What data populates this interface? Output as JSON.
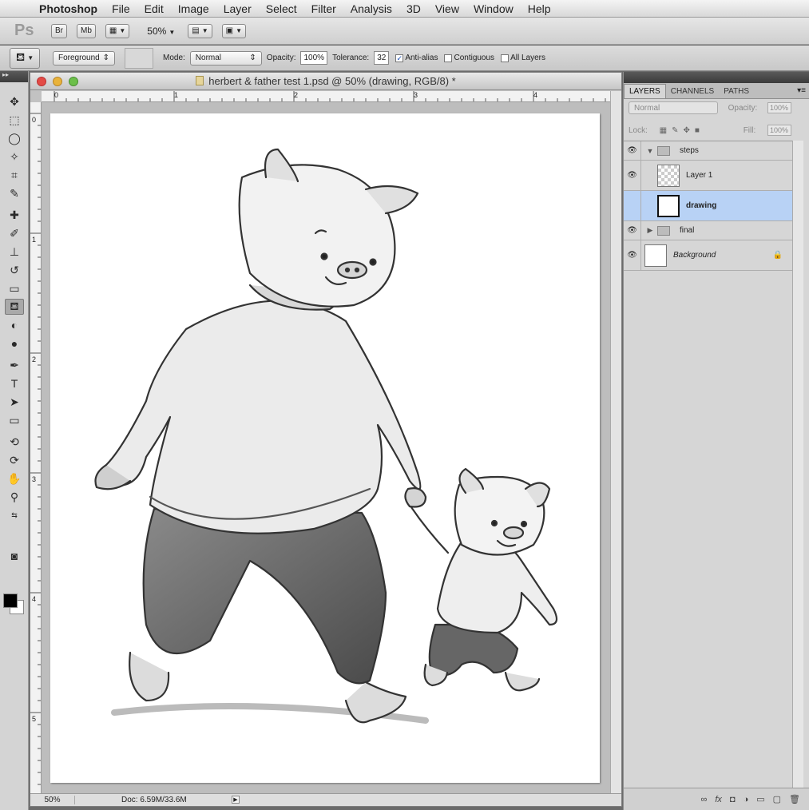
{
  "menubar": {
    "items": [
      "Photoshop",
      "File",
      "Edit",
      "Image",
      "Layer",
      "Select",
      "Filter",
      "Analysis",
      "3D",
      "View",
      "Window",
      "Help"
    ]
  },
  "appbar": {
    "logo": "Ps",
    "bridge_label": "Br",
    "minibridge_label": "Mb",
    "zoom": "50%"
  },
  "options": {
    "fill_source": "Foreground",
    "mode_label": "Mode:",
    "mode_value": "Normal",
    "opacity_label": "Opacity:",
    "opacity_value": "100%",
    "tolerance_label": "Tolerance:",
    "tolerance_value": "32",
    "antialias_label": "Anti-alias",
    "antialias_checked": true,
    "contiguous_label": "Contiguous",
    "contiguous_checked": false,
    "alllayers_label": "All Layers",
    "alllayers_checked": false
  },
  "document": {
    "title": "herbert & father test 1.psd @ 50% (drawing, RGB/8) *",
    "hruler_labels": [
      "0",
      "1",
      "2",
      "3",
      "4"
    ],
    "vruler_labels": [
      "0",
      "1",
      "2",
      "3",
      "4",
      "5"
    ],
    "status_zoom": "50%",
    "status_doc": "Doc: 6.59M/33.6M"
  },
  "layers_panel": {
    "tabs": [
      "LAYERS",
      "CHANNELS",
      "PATHS"
    ],
    "active_tab": "LAYERS",
    "blend_mode": "Normal",
    "opacity_label": "Opacity:",
    "opacity_value": "100%",
    "lock_label": "Lock:",
    "fill_label": "Fill:",
    "fill_value": "100%",
    "layers": [
      {
        "name": "steps",
        "type": "group",
        "expanded": true,
        "visible": true
      },
      {
        "name": "Layer 1",
        "type": "layer",
        "visible": true
      },
      {
        "name": "drawing",
        "type": "layer",
        "visible": false,
        "selected": true
      },
      {
        "name": "final",
        "type": "group",
        "expanded": false,
        "visible": true
      },
      {
        "name": "Background",
        "type": "background",
        "visible": true,
        "locked": true
      }
    ]
  }
}
